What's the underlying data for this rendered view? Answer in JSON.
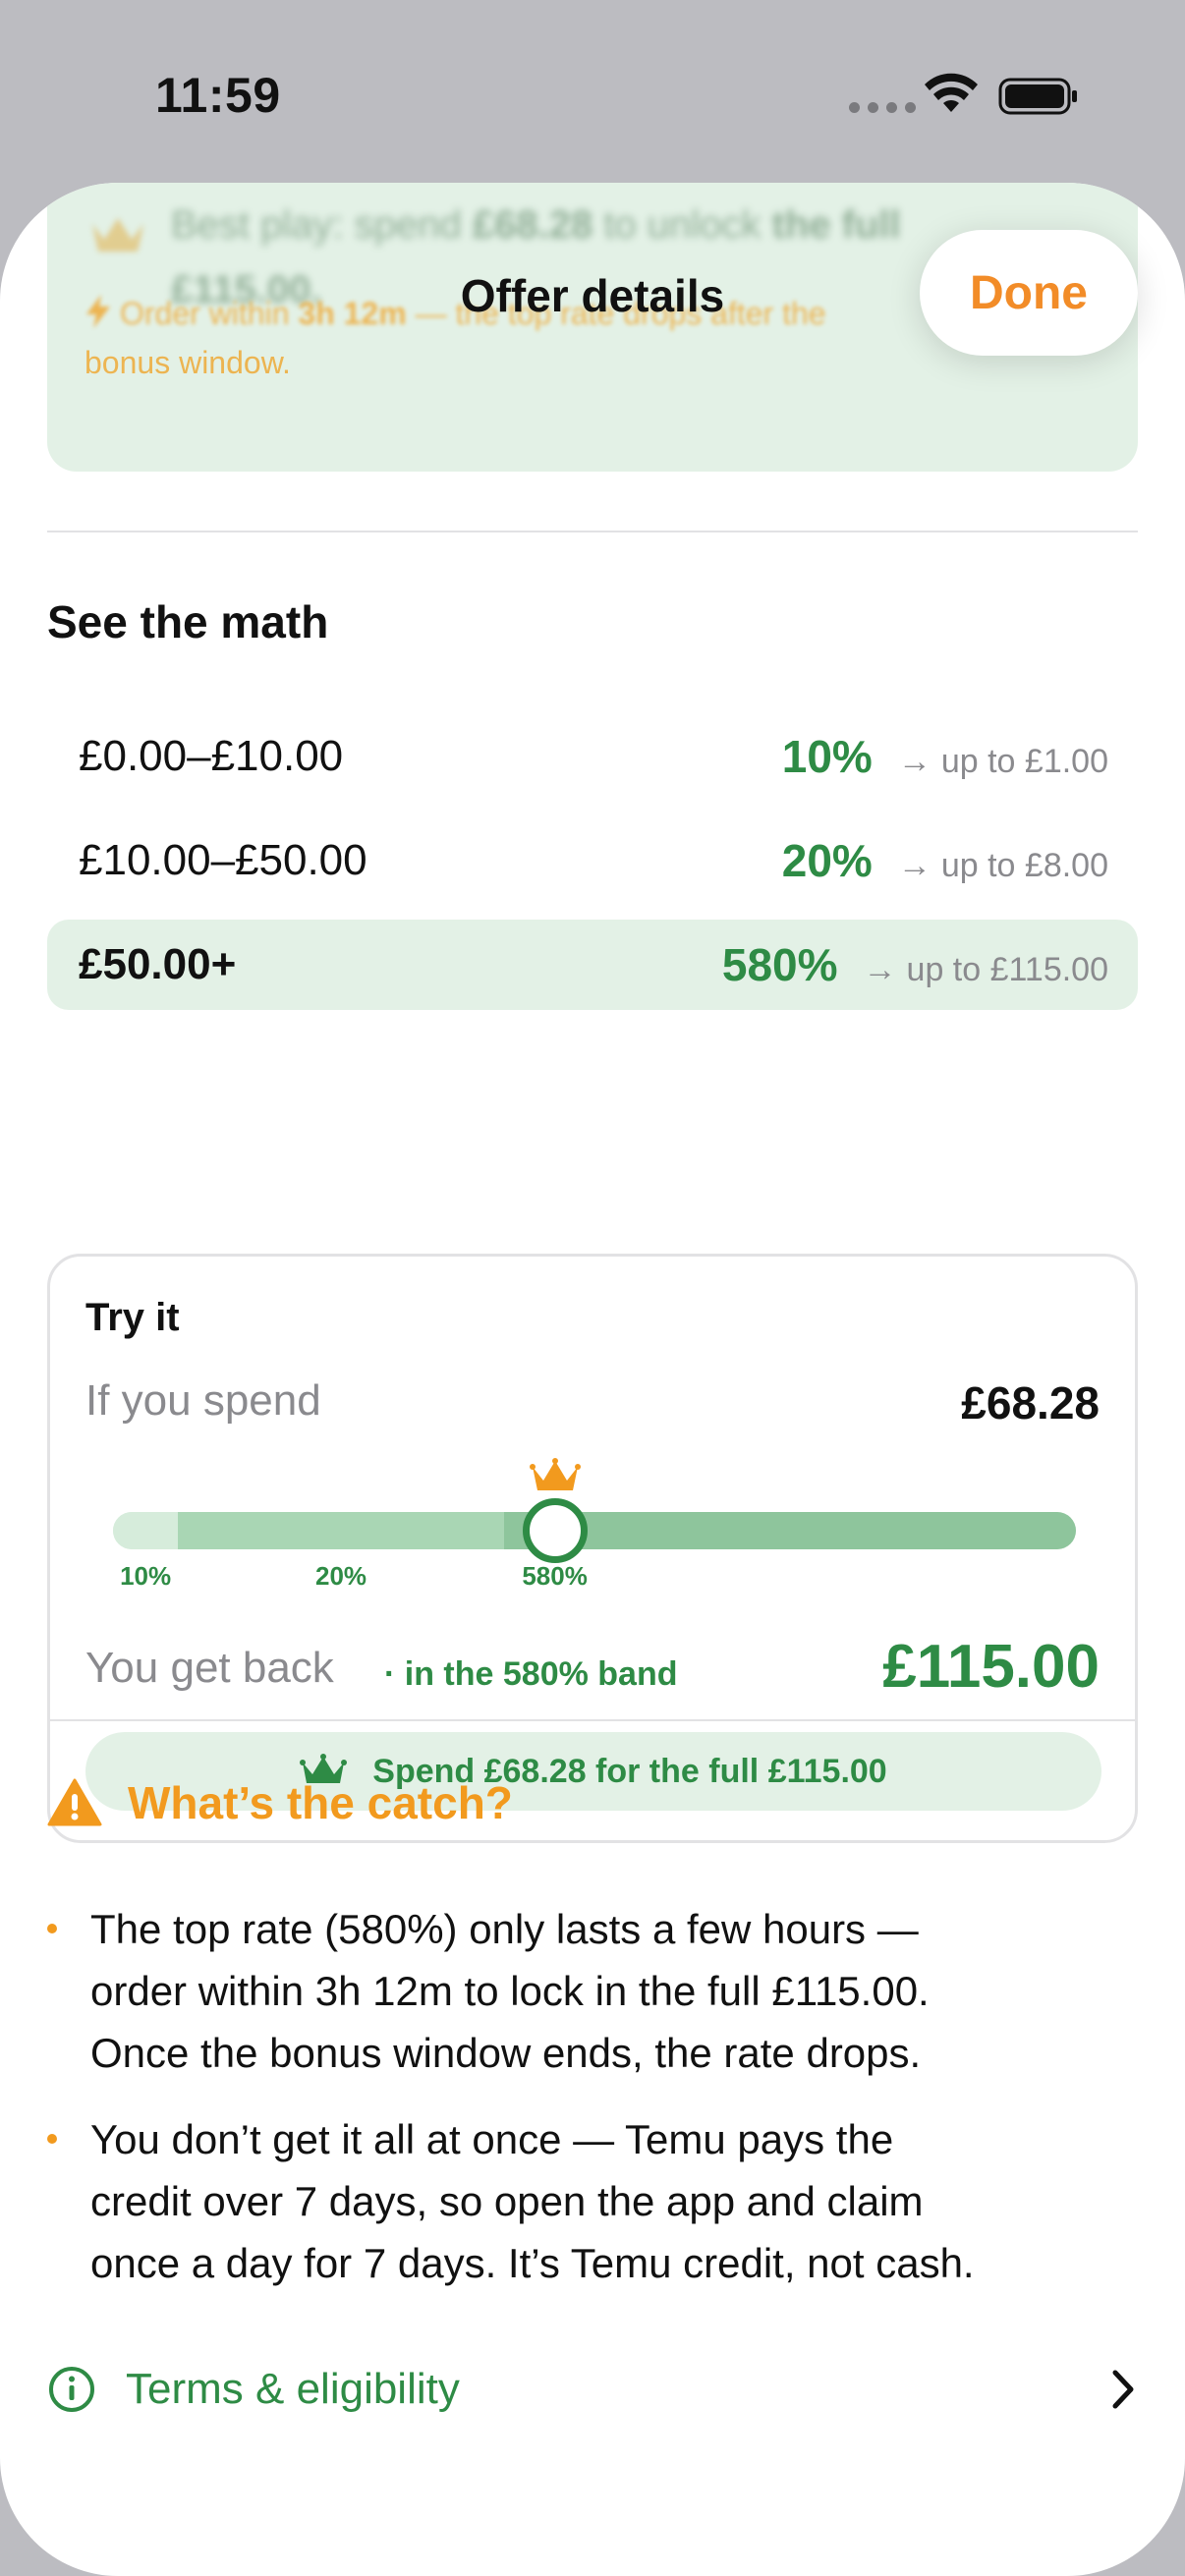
{
  "status_bar": {
    "time": "11:59"
  },
  "sheet": {
    "title": "Offer details",
    "done_label": "Done"
  },
  "summary": {
    "line_prefix": "Best play: spend ",
    "line_spend": "£68.28",
    "line_mid": " to unlock ",
    "line_tail": "the full",
    "line_amount": "£115.00.",
    "urgency_prefix": "Order within ",
    "urgency_time": "3h 12m",
    "urgency_suffix": " — the top rate drops after the",
    "urgency_line2": "bonus window."
  },
  "math": {
    "title": "See the math",
    "tiers": [
      {
        "range": "£0.00–£10.00",
        "rate": "10%",
        "arrow": "→",
        "cap": "up to £1.00"
      },
      {
        "range": "£10.00–£50.00",
        "rate": "20%",
        "arrow": "→",
        "cap": "up to £8.00"
      },
      {
        "range": "£50.00+",
        "rate": "580%",
        "arrow": "→",
        "cap": "up to £115.00"
      }
    ]
  },
  "try_it": {
    "title": "Try it",
    "spend_label": "If you spend",
    "spend_value": "£68.28",
    "slider": {
      "position": 0.459,
      "segments": [
        0.0675,
        0.3385,
        0.594
      ],
      "ticks": [
        "10%",
        "20%",
        "580%"
      ]
    },
    "get_back_label": "You get back",
    "band_label": "· in the 580% band",
    "get_back_value": "£115.00",
    "pill_label": "Spend £68.28 for the full £115.00"
  },
  "catch": {
    "title": "What’s the catch?",
    "bullets": [
      {
        "line1": "The top rate (580%) only lasts a few hours —",
        "line2": "order within 3h 12m to lock in the full £115.00.",
        "line3": "Once the bonus window ends, the rate drops."
      },
      {
        "line1": "You don’t get it all at once — Temu pays the",
        "line2": "credit over 7 days, so open the app and claim",
        "line3": "once a day for 7 days. It’s Temu credit, not cash."
      }
    ]
  },
  "terms": {
    "label": "Terms & eligibility"
  },
  "colors": {
    "accent_green": "#2e8b45",
    "accent_orange": "#f28c28",
    "warning_orange": "#f29a1e",
    "highlight_bg": "#e3f1e6"
  }
}
